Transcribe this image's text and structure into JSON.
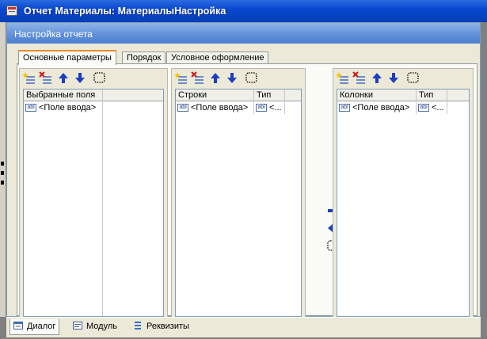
{
  "window": {
    "title": "Отчет Материалы: МатериалыНастройка",
    "dialog_title": "Настройка отчета"
  },
  "tabs": [
    {
      "label": "Основные параметры",
      "active": true
    },
    {
      "label": "Порядок",
      "active": false
    },
    {
      "label": "Условное оформление",
      "active": false
    }
  ],
  "panels": {
    "selected_fields": {
      "columns": [
        "Выбранные поля",
        ""
      ],
      "rows": [
        [
          "<Поле ввода>",
          ""
        ]
      ]
    },
    "rows": {
      "columns": [
        "Строки",
        "Тип"
      ],
      "rows": [
        [
          "<Поле ввода>",
          "<..."
        ]
      ]
    },
    "columns": {
      "columns": [
        "Колонки",
        "Тип"
      ],
      "rows": [
        [
          "<Поле ввода>",
          "<..."
        ]
      ]
    }
  },
  "field_icon_text": "abl",
  "icons": {
    "add": "add-row-icon",
    "delete": "delete-row-icon",
    "up": "move-up-arrow-icon",
    "down": "move-down-arrow-icon",
    "group": "dotted-frame-icon",
    "right": "move-right-arrow-icon",
    "left": "move-left-arrow-icon"
  },
  "bottom_tabs": [
    {
      "label": "Диалог",
      "active": true,
      "icon": "dialog-icon"
    },
    {
      "label": "Модуль",
      "active": false,
      "icon": "module-icon"
    },
    {
      "label": "Реквизиты",
      "active": false,
      "icon": "attributes-icon"
    }
  ],
  "colors": {
    "titlebar": "#0a49cf",
    "dialog_title": "#6b98dc",
    "arrow_blue": "#1c3fbf",
    "delete_red": "#d01818"
  }
}
